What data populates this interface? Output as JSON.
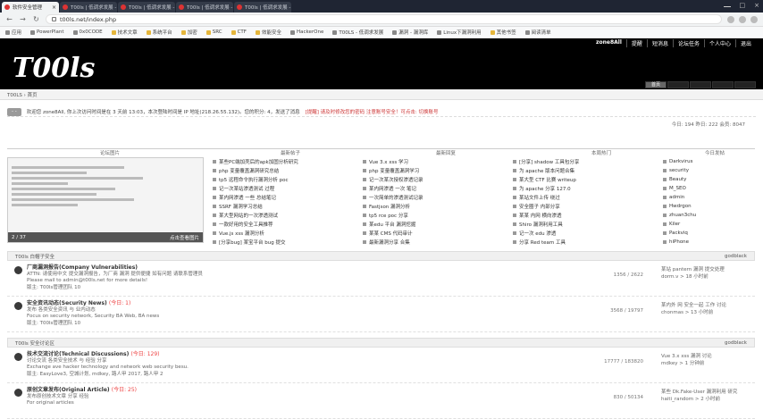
{
  "browser": {
    "tabs": [
      {
        "label": "软件安全管理"
      },
      {
        "label": "T00ls | 低调求发展 - 潜心习安全 - P..."
      },
      {
        "label": "T00ls | 低调求发展 - 潜心..."
      },
      {
        "label": "T00ls | 低调求发展 - 潜心习安..."
      },
      {
        "label": "T00ls | 低调求发展 - 潜心习安..."
      }
    ],
    "url": "t00ls.net/index.php",
    "bookmarks": [
      "应用",
      "PowerPlant",
      "0x0CODE",
      "技术文章",
      "系统平台",
      "加密",
      "SRC",
      "CTF",
      "效能安全",
      "HackerOne",
      "T00LS - 低调求发展",
      "漏洞 - 漏洞库",
      "Linux下漏洞利用",
      "其他书签",
      "阅读清单"
    ]
  },
  "site": {
    "top_links": [
      "zone8All",
      "提醒",
      "短消息",
      "论坛任务",
      "个人中心",
      "退出"
    ],
    "logo_text": "T00ls",
    "nav_active": "首页",
    "breadcrumb": "T00LS › 首页"
  },
  "notice": {
    "button": "- -",
    "text": "欢迎您 zone8All, 你上次访问时间是在 3 天前 13:03，本次登陆时间是 IP 地址(218.26.55.132)。您的积分: 4，发送了消息",
    "highlight": "[提醒] 请及时修改您的密码  注意账号安全！可点击: 切换账号"
  },
  "stats": "今日: 194  昨日: 222  会员: 8047",
  "hot": {
    "headings": [
      "论坛图片",
      "最新帖子",
      "最新回复",
      "本周热门",
      "今日发帖"
    ],
    "slider_caption_left": "2 / 37",
    "slider_caption_right": "点击查看图片",
    "new_posts": [
      "某些PC端加壳后的apk加固分析研究",
      "php 变量覆盖漏洞研究总结",
      "tp5 远程命令执行漏洞分析 poc",
      "记一次某站渗透测试 过程",
      "某内网渗透 一些 总结笔记",
      "SSRF 漏洞学习总结",
      "某大型网站的一次渗透测试",
      "一款好用的安全工具推荐",
      "Vue.js xss 漏洞分析",
      "[分享bug] 某宝平台 bug 提交"
    ],
    "new_replies": [
      "Vue 3.x xss 学习",
      "php 变量覆盖漏洞学习",
      "记一次某次授权渗透记录",
      "某内网渗透 一次 笔记",
      "一次简单的渗透测试记录",
      "Fastjson 漏洞分析",
      "tp5 rce poc 分享",
      "某edu 平台 漏洞挖掘",
      "某某 CMS 代码审计",
      "最新漏洞分享 合集"
    ],
    "week_hot": [
      "[分享] shadow 工具包分享",
      "为 apache 版本问题合集",
      "某大型 CTF 比赛 writeup",
      "为 apache 分享 127.0",
      "某站文件上传 绕过",
      "安全圈子 内部分享",
      "某某 内网 横向渗透",
      "Shiro 漏洞利用工具",
      "记一次 edu 渗透",
      "分享 Red team 工具"
    ],
    "today_posters": [
      "Darkvirus",
      "security",
      "Beauty",
      "M_SEO",
      "admin",
      "Hwdrgon",
      "zhuan3chu",
      "Kiler",
      "Packviq",
      "hiPhone"
    ]
  },
  "sections": [
    {
      "title": "T00ls 白帽子安全",
      "moderator": "godblack",
      "forums": [
        {
          "name": "厂商漏洞报告(Company Vulnerabilities)",
          "today": "",
          "desc1": "ATTN: 请使用中文 提交漏洞报告，为厂商 漏洞 提供便捷 如有问题 请联系管理员",
          "desc2": "Please mail to admin@t00ls.net for more details!",
          "mods": "版主: T00ls管理团队 10",
          "nums": "1356 / 2622",
          "last1": "某站 pantern 漏洞 提交处理",
          "last2": "dorm.v > 18 小时前"
        },
        {
          "name": "安全资讯动态(Security News)",
          "today": "(今日: 1)",
          "desc1": "发布 各类安全资讯 与 业内动态",
          "desc2": "Focus on security network, Security BA Web, BA news",
          "mods": "版主: T00ls管理团队 10",
          "nums": "3568 / 19797",
          "last1": "某内外 网 安全一起 工作 讨论",
          "last2": "chonmas > 13 小时前"
        }
      ]
    },
    {
      "title": "T00ls 安全讨论区",
      "moderator": "godblack",
      "forums": [
        {
          "name": "技术交流讨论(Technical Discussions)",
          "today": "(今日: 129)",
          "desc1": "讨论交流 各类安全技术 与 经验 分享",
          "desc2": "Exchange ave hacker technology and network web security besu.",
          "mods": "版主: EasyLove3, 空城计划, mdkey, 路人甲 2017, 路人甲 2",
          "nums": "17777 / 183820",
          "last1": "Vue 3.x xss 漏洞 讨论",
          "last2": "mdkey > 1 分钟前"
        },
        {
          "name": "原创文章发布(Original Article)",
          "today": "(今日: 25)",
          "desc1": "发布原创技术文章 分享 经验",
          "desc2": "For original articles",
          "mods": "",
          "nums": "830 / 50134",
          "last1": "某些 Dk.Fake-User 漏洞利用 研究",
          "last2": "haiti_random > 2 小时前"
        }
      ]
    }
  ]
}
